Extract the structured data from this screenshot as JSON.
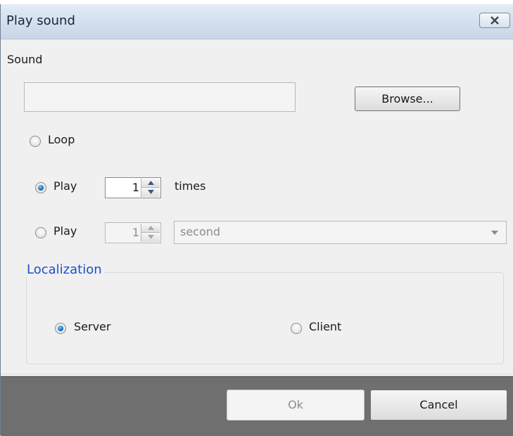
{
  "window": {
    "title": "Play sound"
  },
  "sound": {
    "label": "Sound",
    "value": "",
    "browse_label": "Browse..."
  },
  "options": {
    "loop_label": "Loop",
    "play_times": {
      "label": "Play",
      "value": "1",
      "suffix": "times",
      "checked": true
    },
    "play_duration": {
      "label": "Play",
      "value": "1",
      "unit": "second",
      "checked": false
    }
  },
  "localization": {
    "legend": "Localization",
    "server_label": "Server",
    "client_label": "Client",
    "selected": "Server"
  },
  "footer": {
    "ok_label": "Ok",
    "cancel_label": "Cancel"
  },
  "colors": {
    "legend": "#1a4fcf",
    "footer_bg": "#6f6f6f",
    "radio_selected": "#1769b8"
  }
}
